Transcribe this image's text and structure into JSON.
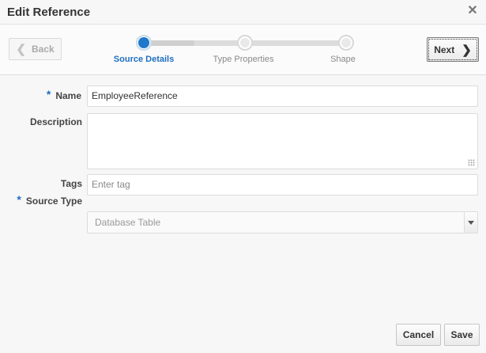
{
  "dialog": {
    "title": "Edit Reference",
    "close_icon": "close-icon"
  },
  "train": {
    "back_label": "Back",
    "next_label": "Next",
    "steps": [
      {
        "label": "Source Details",
        "state": "active"
      },
      {
        "label": "Type Properties",
        "state": "pending"
      },
      {
        "label": "Shape",
        "state": "pending"
      }
    ]
  },
  "form": {
    "name": {
      "label": "Name",
      "required": true,
      "value": "EmployeeReference"
    },
    "description": {
      "label": "Description",
      "value": ""
    },
    "tags": {
      "label": "Tags",
      "placeholder": "Enter tag"
    },
    "source_type": {
      "label": "Source Type",
      "required": true,
      "value": "Database Table"
    }
  },
  "footer": {
    "cancel_label": "Cancel",
    "save_label": "Save"
  },
  "colors": {
    "accent": "#1f77c9",
    "active_step_text": "#1f6fbf"
  }
}
